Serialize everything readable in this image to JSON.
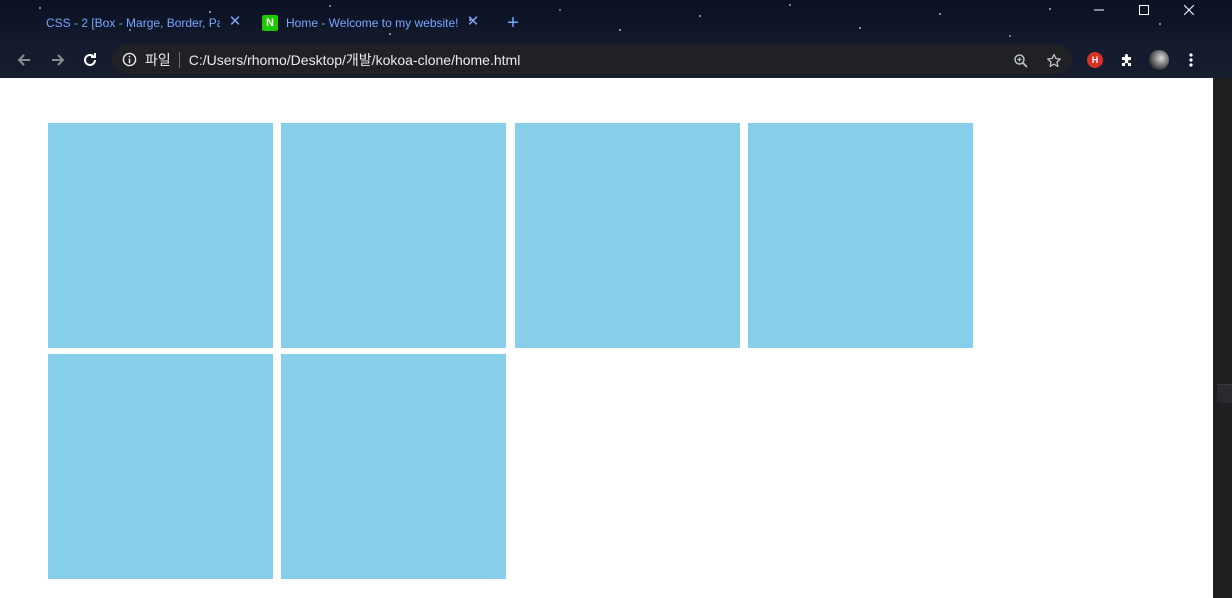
{
  "tabs": [
    {
      "title": "CSS - 2 [Box - Marge, Border, Pa",
      "active": false
    },
    {
      "title": "Home - Welcome to my website!",
      "favicon_letter": "N",
      "favicon_color": "#1ec800",
      "active": true
    }
  ],
  "new_tab_glyph": "+",
  "close_glyph": "✕",
  "toolbar": {
    "scheme_label": "파일",
    "url": "C:/Users/rhomo/Desktop/개발/kokoa-clone/home.html",
    "ext1_badge": "H"
  },
  "icons": {
    "back": "arrow-left-icon",
    "forward": "arrow-right-icon",
    "reload": "reload-icon",
    "info": "info-icon",
    "zoom": "zoom-icon",
    "star": "star-icon",
    "puzzle": "puzzle-icon",
    "menu": "menu-dots-icon",
    "minimize": "minimize-icon",
    "maximize": "maximize-icon",
    "close": "close-icon"
  },
  "colors": {
    "box": "#87ceeb",
    "tab_text": "#7aa7ff",
    "page_background": "#ffffff"
  },
  "page": {
    "box_count": 6
  }
}
